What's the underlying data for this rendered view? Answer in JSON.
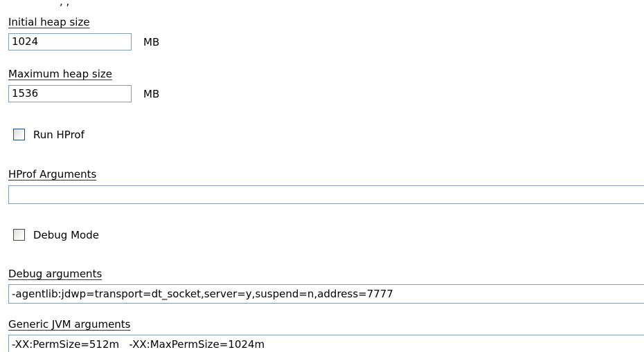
{
  "top_cutoff_text": ", ,",
  "initial_heap": {
    "label": "Initial heap size",
    "value": "1024",
    "unit": "MB"
  },
  "maximum_heap": {
    "label": "Maximum heap size",
    "value": "1536",
    "unit": "MB"
  },
  "run_hprof": {
    "label": "Run HProf",
    "checked": false
  },
  "hprof_arguments": {
    "label": "HProf Arguments",
    "value": ""
  },
  "debug_mode": {
    "label": "Debug Mode",
    "checked": false
  },
  "debug_arguments": {
    "label": "Debug arguments",
    "value": "-agentlib:jdwp=transport=dt_socket,server=y,suspend=n,address=7777"
  },
  "generic_jvm_arguments": {
    "label": "Generic JVM arguments",
    "value": "-XX:PermSize=512m   -XX:MaxPermSize=1024m"
  }
}
